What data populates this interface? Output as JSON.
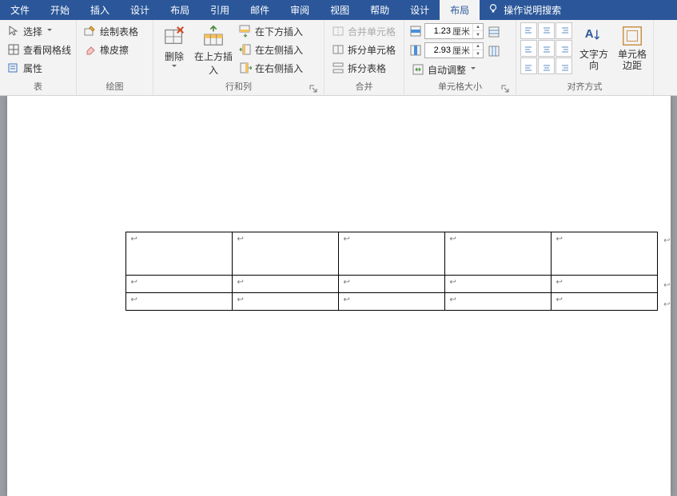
{
  "tabs": {
    "file": "文件",
    "home": "开始",
    "insert": "插入",
    "design": "设计",
    "layout": "布局",
    "references": "引用",
    "mailings": "邮件",
    "review": "审阅",
    "view": "视图",
    "help": "帮助",
    "table_design": "设计",
    "table_layout": "布局"
  },
  "tell_me": "操作说明搜索",
  "groups": {
    "table": {
      "label": "表",
      "select": "选择",
      "view_gridlines": "查看网格线",
      "properties": "属性"
    },
    "draw": {
      "label": "绘图",
      "draw_table": "绘制表格",
      "eraser": "橡皮擦"
    },
    "rows_cols": {
      "label": "行和列",
      "delete": "删除",
      "insert_above": "在上方插入",
      "insert_below": "在下方插入",
      "insert_left": "在左侧插入",
      "insert_right": "在右侧插入"
    },
    "merge": {
      "label": "合并",
      "merge_cells": "合并单元格",
      "split_cells": "拆分单元格",
      "split_table": "拆分表格"
    },
    "cell_size": {
      "label": "单元格大小",
      "height_value": "1.23",
      "width_value": "2.93",
      "unit": "厘米",
      "autofit": "自动调整"
    },
    "alignment": {
      "label": "对齐方式",
      "text_direction": "文字方向",
      "cell_margins": "单元格边距"
    }
  },
  "table_data": {
    "rows": 3,
    "cols": 5
  }
}
